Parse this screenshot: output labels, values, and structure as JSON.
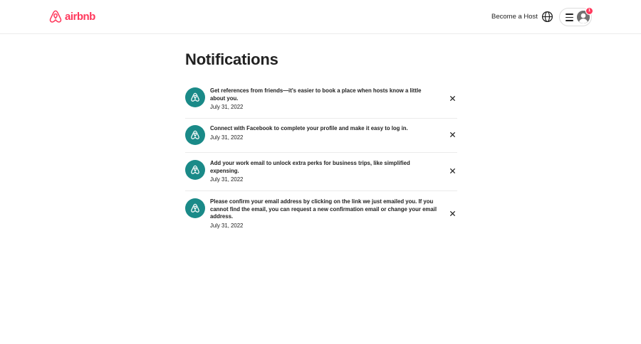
{
  "brand": {
    "name": "airbnb",
    "color": "#FF385C",
    "icon": "airbnb-logo-icon"
  },
  "header": {
    "become_host": "Become a Host",
    "globe_icon": "globe-icon",
    "menu_icon": "hamburger-menu-icon",
    "avatar_icon": "user-avatar",
    "notification_count": "1"
  },
  "page": {
    "title": "Notifications"
  },
  "notifications": [
    {
      "message": "Get references from friends—it's easier to book a place when hosts know a little about you.",
      "date": "July 31, 2022",
      "icon": "airbnb-logo-icon"
    },
    {
      "message": "Connect with Facebook to complete your profile and make it easy to log in.",
      "date": "July 31, 2022",
      "icon": "airbnb-logo-icon"
    },
    {
      "message": "Add your work email to unlock extra perks for business trips, like simplified expensing.",
      "date": "July 31, 2022",
      "icon": "airbnb-logo-icon"
    },
    {
      "message": "Please confirm your email address by clicking on the link we just emailed you. If you cannot find the email, you can request a new confirmation email or change your email address.",
      "date": "July 31, 2022",
      "icon": "airbnb-logo-icon"
    }
  ],
  "colors": {
    "accent": "#FF385C",
    "notif_avatar": "#1a8a88",
    "text": "#222222",
    "divider": "#ebebeb"
  }
}
